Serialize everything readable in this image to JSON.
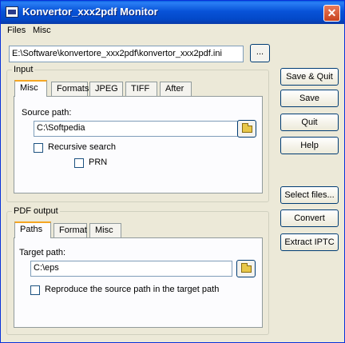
{
  "window": {
    "title": "Konvertor_xxx2pdf Monitor"
  },
  "menu": {
    "files": "Files",
    "misc": "Misc"
  },
  "config": {
    "path": "E:\\Software\\konvertore_xxx2pdf\\konvertor_xxx2pdf.ini",
    "browse_label": "..."
  },
  "input": {
    "group_label": "Input",
    "tabs": [
      "Misc",
      "Formats",
      "JPEG",
      "TIFF",
      "After"
    ],
    "active_tab": "Misc",
    "source_label": "Source path:",
    "source_value": "C:\\Softpedia",
    "recursive_label": "Recursive search",
    "recursive_checked": false,
    "prn_label": "PRN",
    "prn_checked": false
  },
  "output": {
    "group_label": "PDF output",
    "tabs": [
      "Paths",
      "Format",
      "Misc"
    ],
    "active_tab": "Paths",
    "target_label": "Target path:",
    "target_value": "C:\\eps",
    "reproduce_label": "Reproduce the source path in the target path",
    "reproduce_checked": false
  },
  "buttons": {
    "save_quit": "Save & Quit",
    "save": "Save",
    "quit": "Quit",
    "help": "Help",
    "select_files": "Select files...",
    "convert": "Convert",
    "extract_iptc": "Extract IPTC"
  },
  "icons": {
    "title": "app-window-icon",
    "close": "close-icon",
    "folder": "folder-icon"
  }
}
